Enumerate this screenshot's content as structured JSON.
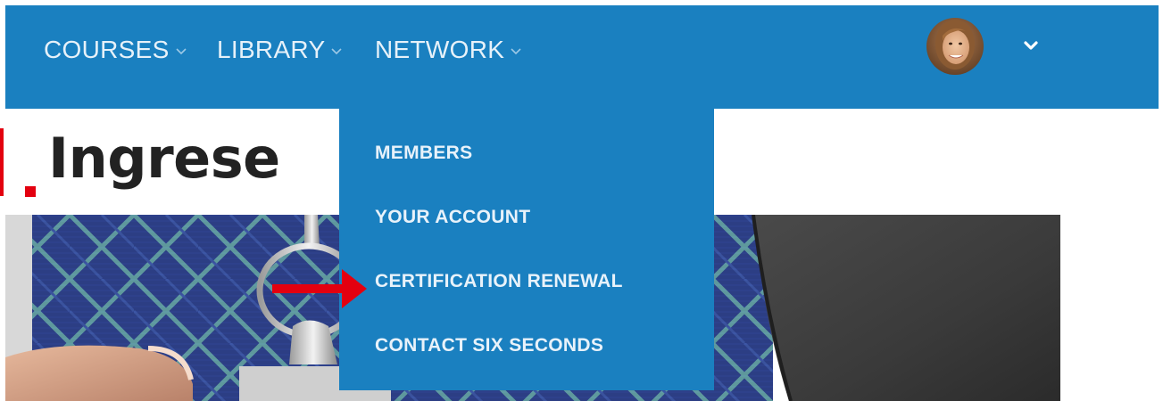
{
  "nav": {
    "items": [
      {
        "label": "COURSES"
      },
      {
        "label": "LIBRARY"
      },
      {
        "label": "NETWORK"
      }
    ]
  },
  "page": {
    "title": "Ingrese"
  },
  "dropdown": {
    "items": [
      {
        "label": "MEMBERS"
      },
      {
        "label": "YOUR ACCOUNT"
      },
      {
        "label": "CERTIFICATION RENEWAL"
      },
      {
        "label": "CONTACT SIX SECONDS"
      }
    ]
  },
  "colors": {
    "nav_bg": "#1a80c0",
    "accent_red": "#e3000f",
    "text_dark": "#222222"
  },
  "icons": {
    "nav_caret": "chevron-down-icon",
    "user_menu": "chevron-down-icon",
    "annotation": "arrow-right-icon"
  }
}
